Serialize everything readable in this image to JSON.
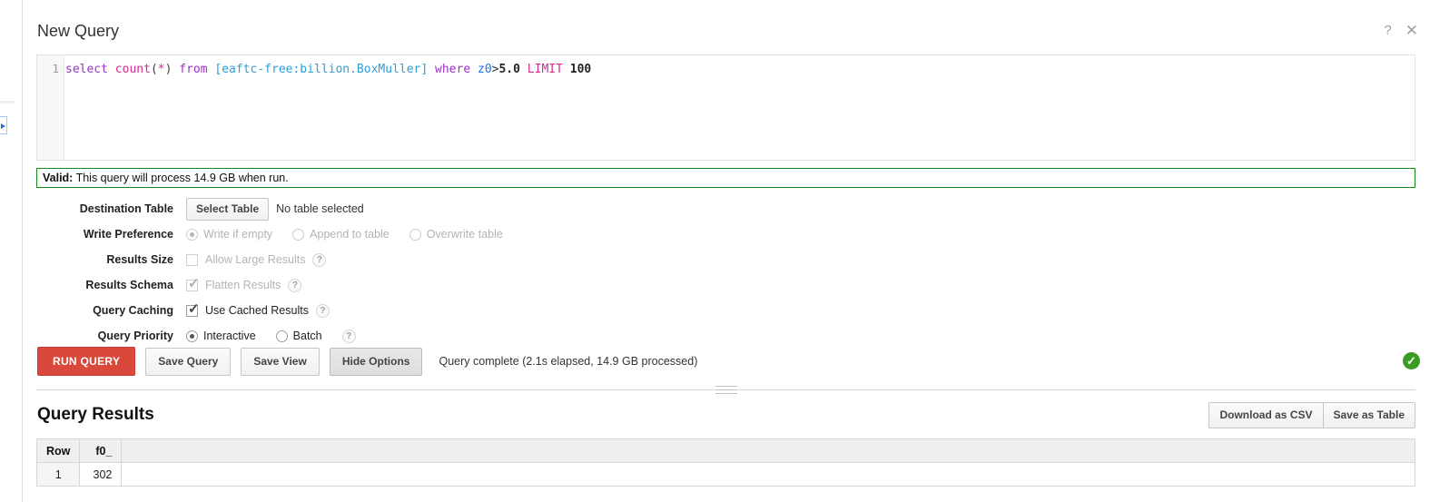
{
  "window": {
    "title": "New Query",
    "help_icon": "question-mark-icon",
    "close_icon": "close-x-icon",
    "help_glyph": "?",
    "close_glyph": "✕"
  },
  "editor": {
    "line_number": "1",
    "query_full": "select count(*) from [eaftc-free:billion.BoxMuller] where z0>5.0 LIMIT 100",
    "tokens": {
      "select": "select",
      "space1": " ",
      "count": "count",
      "paren_open": "(",
      "star": "*",
      "paren_close": ")",
      "space2": " ",
      "from": "from",
      "space3": " ",
      "table": "[eaftc-free:billion.BoxMuller]",
      "space4": " ",
      "where": "where",
      "space5": " ",
      "column": "z0",
      "operator": ">",
      "value": "5.0",
      "space6": " ",
      "limit": "LIMIT",
      "space7": " ",
      "limit_value": "100"
    }
  },
  "validation": {
    "label": "Valid:",
    "message": " This query will process 14.9 GB when run.",
    "border_color": "#1a8a1a"
  },
  "options": {
    "destination_table": {
      "label": "Destination Table",
      "select_button": "Select Table",
      "status": "No table selected"
    },
    "write_preference": {
      "label": "Write Preference",
      "choices": [
        {
          "text": "Write if empty",
          "selected": true,
          "disabled": true
        },
        {
          "text": "Append to table",
          "selected": false,
          "disabled": true
        },
        {
          "text": "Overwrite table",
          "selected": false,
          "disabled": true
        }
      ]
    },
    "results_size": {
      "label": "Results Size",
      "checkbox_text": "Allow Large Results",
      "checked": false,
      "disabled": true,
      "help_glyph": "?"
    },
    "results_schema": {
      "label": "Results Schema",
      "checkbox_text": "Flatten Results",
      "checked": true,
      "disabled": true,
      "help_glyph": "?"
    },
    "query_caching": {
      "label": "Query Caching",
      "checkbox_text": "Use Cached Results",
      "checked": true,
      "disabled": false,
      "help_glyph": "?"
    },
    "query_priority": {
      "label": "Query Priority",
      "choices": [
        {
          "text": "Interactive",
          "selected": true,
          "disabled": false
        },
        {
          "text": "Batch",
          "selected": false,
          "disabled": false
        }
      ],
      "help_glyph": "?"
    }
  },
  "actions": {
    "run_query": "RUN QUERY",
    "save_query": "Save Query",
    "save_view": "Save View",
    "hide_options": "Hide Options",
    "status": "Query complete (2.1s elapsed, 14.9 GB processed)",
    "success_glyph": "✓",
    "success_color": "#3a9b25",
    "run_button_color": "#d9483a"
  },
  "results": {
    "title": "Query Results",
    "download_csv": "Download as CSV",
    "save_as_table": "Save as Table",
    "columns": [
      "Row",
      "f0_"
    ],
    "rows": [
      {
        "row": "1",
        "f0_": "302"
      }
    ]
  }
}
